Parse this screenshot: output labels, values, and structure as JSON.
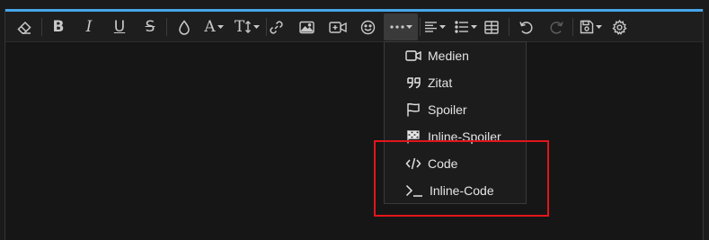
{
  "colors": {
    "accent": "#47a7eb",
    "highlight": "#e3151b",
    "toolbar_bg": "#1e1e1e",
    "menu_bg": "#1c1c1c",
    "text": "#e4e4e4"
  },
  "toolbar": {
    "buttons": [
      {
        "id": "clear-formatting",
        "icon": "eraser-icon"
      },
      {
        "id": "bold",
        "icon": "bold-icon",
        "glyph": "B"
      },
      {
        "id": "italic",
        "icon": "italic-icon",
        "glyph": "I"
      },
      {
        "id": "underline",
        "icon": "underline-icon",
        "glyph": "U"
      },
      {
        "id": "strikethrough",
        "icon": "strikethrough-icon",
        "glyph": "S"
      },
      {
        "id": "text-color",
        "icon": "droplet-icon"
      },
      {
        "id": "font-family",
        "icon": "font-icon",
        "glyph": "A"
      },
      {
        "id": "font-size",
        "icon": "text-size-icon",
        "glyph": "T"
      },
      {
        "id": "insert-link",
        "icon": "link-icon"
      },
      {
        "id": "insert-image",
        "icon": "image-icon"
      },
      {
        "id": "insert-media",
        "icon": "video-plus-icon"
      },
      {
        "id": "insert-smilie",
        "icon": "smile-icon"
      },
      {
        "id": "more-insert",
        "icon": "ellipsis-icon",
        "active": true
      },
      {
        "id": "alignment",
        "icon": "align-left-icon"
      },
      {
        "id": "list",
        "icon": "list-icon"
      },
      {
        "id": "insert-table",
        "icon": "table-icon"
      },
      {
        "id": "undo",
        "icon": "undo-icon"
      },
      {
        "id": "redo",
        "icon": "redo-icon",
        "disabled": true
      },
      {
        "id": "drafts",
        "icon": "save-icon"
      },
      {
        "id": "settings",
        "icon": "gear-icon"
      }
    ]
  },
  "insert_menu": {
    "items": [
      {
        "label": "Medien",
        "icon": "video-icon"
      },
      {
        "label": "Zitat",
        "icon": "quote-icon"
      },
      {
        "label": "Spoiler",
        "icon": "flag-icon"
      },
      {
        "label": "Inline-Spoiler",
        "icon": "checkered-flag-icon"
      },
      {
        "label": "Code",
        "icon": "code-icon"
      },
      {
        "label": "Inline-Code",
        "icon": "terminal-icon"
      }
    ]
  }
}
